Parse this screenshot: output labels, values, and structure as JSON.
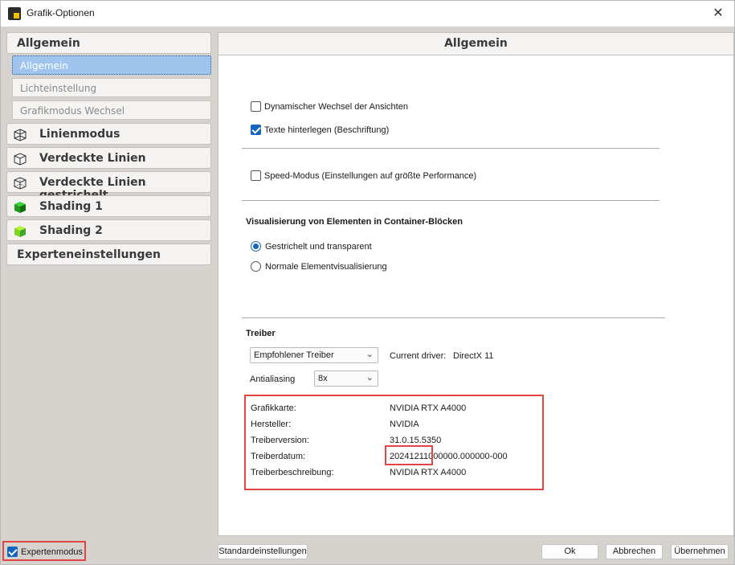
{
  "window": {
    "title": "Grafik-Optionen"
  },
  "sidebar": {
    "categories": [
      {
        "label": "Allgemein",
        "icon": "none"
      },
      {
        "label": "Linienmodus",
        "icon": "wireframe-cube-icon"
      },
      {
        "label": "Verdeckte Linien",
        "icon": "hidden-lines-cube-icon"
      },
      {
        "label": "Verdeckte Linien gestrichelt",
        "icon": "dashed-cube-icon"
      },
      {
        "label": "Shading 1",
        "icon": "green-cube-icon"
      },
      {
        "label": "Shading 2",
        "icon": "yellow-green-cube-icon"
      },
      {
        "label": "Experteneinstellungen",
        "icon": "none"
      }
    ],
    "subitems": [
      {
        "label": "Allgemein",
        "selected": true
      },
      {
        "label": "Lichteinstellung",
        "selected": false
      },
      {
        "label": "Grafikmodus Wechsel",
        "selected": false
      }
    ]
  },
  "main": {
    "header": "Allgemein",
    "options": {
      "dynamic_switch": {
        "label": "Dynamischer Wechsel der Ansichten",
        "checked": false
      },
      "text_background": {
        "label": "Texte hinterlegen (Beschriftung)",
        "checked": true
      },
      "speed_mode": {
        "label": "Speed-Modus (Einstellungen auf größte Performance)",
        "checked": false
      }
    },
    "container_section": {
      "title": "Visualisierung von Elementen in Container-Blöcken",
      "radio_dashed": {
        "label": "Gestrichelt und transparent",
        "selected": true
      },
      "radio_normal": {
        "label": "Normale Elementvisualisierung",
        "selected": false
      }
    },
    "driver": {
      "title": "Treiber",
      "driver_select": "Empfohlener Treiber",
      "current_driver_label": "Current driver:",
      "current_driver_value": "DirectX 11",
      "antialiasing_label": "Antialiasing",
      "antialiasing_value": "8x"
    },
    "gpu_info": [
      {
        "key": "Grafikkarte:",
        "value": "NVIDIA RTX A4000"
      },
      {
        "key": "Hersteller:",
        "value": "NVIDIA"
      },
      {
        "key": "Treiberversion:",
        "value": "31.0.15.5350"
      },
      {
        "key": "Treiberdatum:",
        "value": "20241211000000.000000-000"
      },
      {
        "key": "Treiberbeschreibung:",
        "value": "NVIDIA RTX A4000"
      }
    ]
  },
  "footer": {
    "expert_mode": {
      "label": "Expertenmodus",
      "checked": true
    },
    "defaults_button": "Standardeinstellungen",
    "ok_button": "Ok",
    "cancel_button": "Abbrechen",
    "apply_button": "Übernehmen"
  },
  "colors": {
    "accent": "#1565c0",
    "highlight_box": "#e04444",
    "selection": "#9fc4ee"
  }
}
